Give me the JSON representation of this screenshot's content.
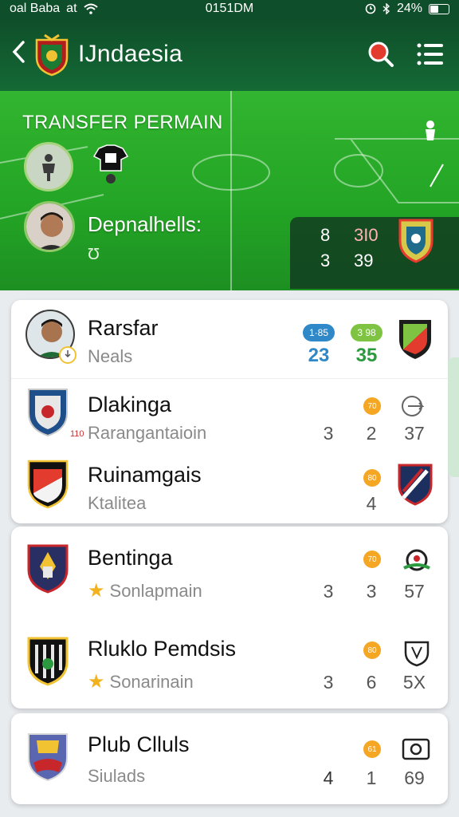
{
  "status_bar": {
    "carrier": "oal Baba",
    "network": "at",
    "time": "0151DM",
    "battery": "24%"
  },
  "header": {
    "title": "IJndaesia",
    "back_icon": "chevron-left-icon",
    "search_icon": "search-icon",
    "menu_icon": "menu-icon"
  },
  "hero": {
    "label": "TRANSFER PERMAIN",
    "player_name": "Depnalhells:",
    "player_sub": "Ʊ",
    "scores": {
      "a1": "8",
      "a2": "3I0",
      "b1": "3",
      "b2": "39"
    }
  },
  "rows": [
    {
      "name": "Rarsfar",
      "sub": "Neals",
      "pill1": "1·85",
      "pill2": "3 98",
      "val1": "23",
      "val2": "35"
    },
    {
      "name": "Dlakinga",
      "sub": "Rarangantaioin",
      "tag": "110",
      "dot": "70",
      "c1": "3",
      "c2": "2",
      "c3": "37"
    },
    {
      "name": "Ruinamgais",
      "sub": "Ktalitea",
      "dot": "80",
      "c2": "4"
    },
    {
      "name": "Bentinga",
      "sub": "Sonlapmain",
      "dot": "70",
      "c1": "3",
      "c2": "3",
      "c3": "57"
    },
    {
      "name": "Rluklo Pemdsis",
      "sub": "Sonarinain",
      "dot": "80",
      "c1": "3",
      "c2": "6",
      "c3": "5X"
    },
    {
      "name": "Plub Clluls",
      "sub": "Siulads",
      "dot": "61",
      "c1": "4",
      "c2": "1",
      "c3": "69"
    }
  ],
  "colors": {
    "header": "#0f4e2a",
    "pitch": "#2aa92a",
    "accent_orange": "#f5a623",
    "accent_blue": "#2f88c8",
    "accent_green": "#7ec342"
  }
}
